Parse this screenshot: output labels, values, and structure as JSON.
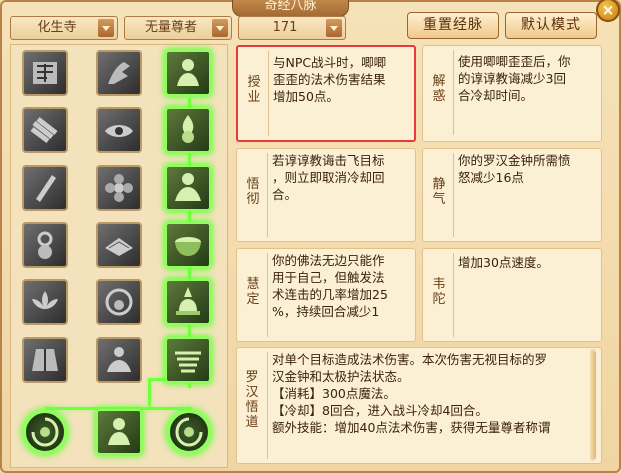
{
  "window": {
    "title": "奇经八脉",
    "close_label": "×"
  },
  "top_bar": {
    "school_select": "化生寺",
    "faction_select": "无量尊者",
    "points_select": "171",
    "reset_button": "重置经脉",
    "default_button": "默认模式"
  },
  "colors": {
    "lit_border": "#8dff5a",
    "selected_border": "#e53b3b",
    "card_bg": "#fbefd4"
  },
  "skill_tree": {
    "icons": [
      [
        "rune-book-icon",
        "shadow-hand-icon",
        "monk-meditate-icon"
      ],
      [
        "scroll-bundle-icon",
        "eye-icon",
        "monk-flame-icon"
      ],
      [
        "scripture-icon",
        "flower-icon",
        "monk-sit-icon"
      ],
      [
        "amulet-icon",
        "pagoda-icon",
        "zen-bowl-icon"
      ],
      [
        "lotus-icon",
        "halo-icon",
        "stupa-icon"
      ],
      [
        "robe-icon",
        "seated-buddha-icon",
        "tiger-icon"
      ]
    ],
    "bottom_nodes": [
      "left-orb-icon",
      "center-monk-icon",
      "right-orb-icon"
    ]
  },
  "abilities": [
    {
      "name": "授业",
      "desc": "与NPC战斗时，唧唧\n歪歪的法术伤害结果\n增加50点。",
      "selected": true
    },
    {
      "name": "解惑",
      "desc": "使用唧唧歪歪后，你\n的谆谆教诲减少3回\n合冷却时间。",
      "selected": false
    },
    {
      "name": "悟彻",
      "desc": "若谆谆教诲击飞目标\n，则立即取消冷却回\n合。",
      "selected": false
    },
    {
      "name": "静气",
      "desc": "你的罗汉金钟所需愤\n怒减少16点",
      "selected": false
    },
    {
      "name": "慧定",
      "desc": "你的佛法无边只能作\n用于自己，但触发法\n术连击的几率增加25\n%，持续回合减少1",
      "selected": false
    },
    {
      "name": "韦陀",
      "desc": "增加30点速度。",
      "selected": false
    },
    {
      "name": "罗汉悟道",
      "desc": "对单个目标造成法术伤害。本次伤害无视目标的罗\n汉金钟和太极护法状态。\n【消耗】300点魔法。\n【冷却】8回合，进入战斗冷却4回合。\n额外技能：增加40点法术伤害，获得无量尊者称谓",
      "selected": false
    }
  ]
}
